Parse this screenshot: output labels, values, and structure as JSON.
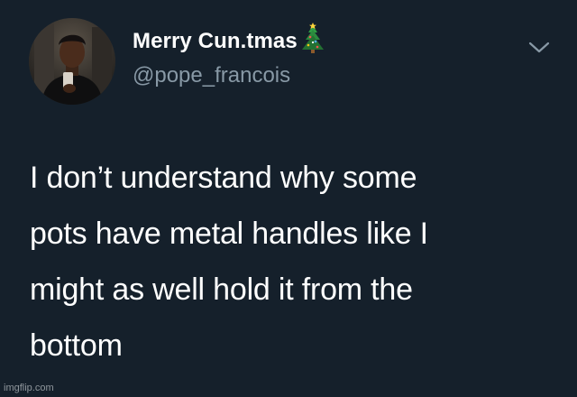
{
  "tweet": {
    "display_name": "Merry Cun.tmas",
    "display_name_icon": "christmas-tree-emoji",
    "handle": "@pope_francois",
    "menu_icon": "chevron-down-icon",
    "text_lines": [
      "I don’t understand why some",
      "pots have metal handles like I",
      "might as well hold it from the",
      "bottom"
    ]
  },
  "watermark": "imgflip.com",
  "colors": {
    "background": "#15202b",
    "primary_text": "#ffffff",
    "secondary_text": "#8899a6"
  }
}
